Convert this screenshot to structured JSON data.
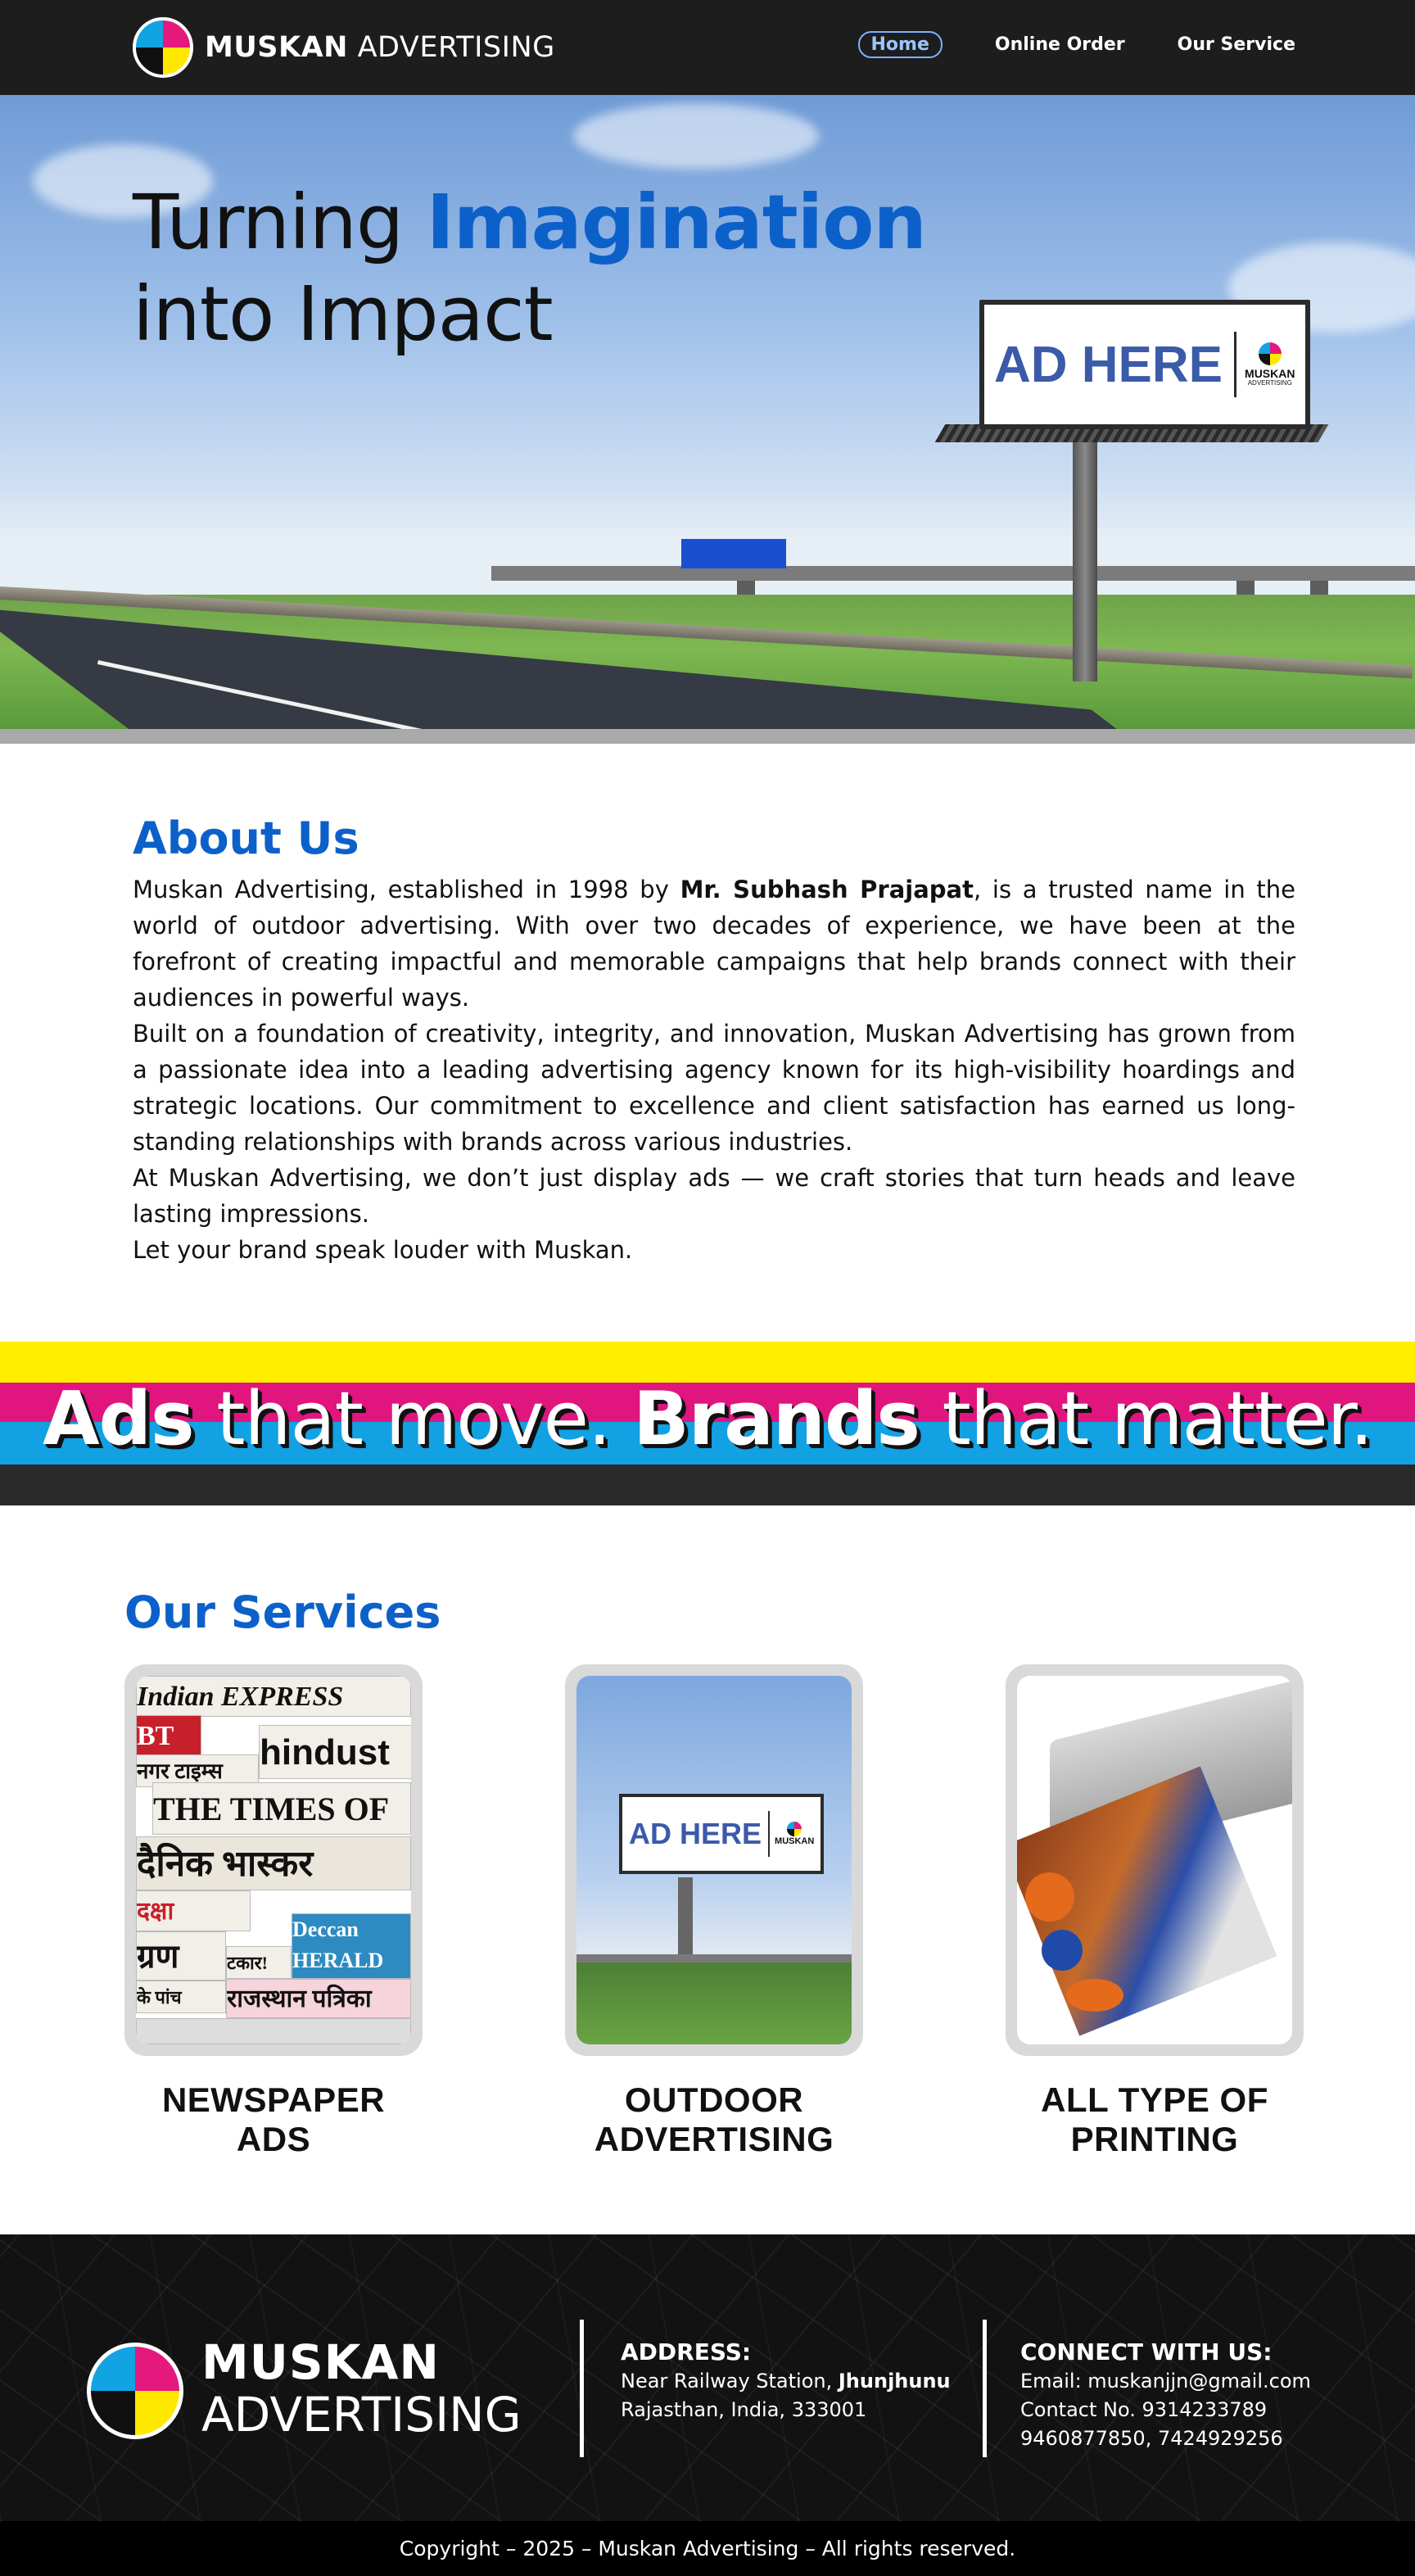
{
  "nav": {
    "brand_bold": "MUSKAN",
    "brand_light": "ADVERTISING",
    "links": [
      {
        "label": "Home",
        "active": true
      },
      {
        "label": "Online Order",
        "active": false
      },
      {
        "label": "Our Service",
        "active": false
      }
    ]
  },
  "hero": {
    "title_part1": "Turning ",
    "title_accent": "Imagination",
    "title_line2": "into Impact",
    "billboard_text": "AD HERE",
    "billboard_brand": "MUSKAN",
    "billboard_sub": "ADVERTISING"
  },
  "about": {
    "title": "About Us",
    "p1_pre": "Muskan Advertising, established in 1998 by ",
    "p1_bold": "Mr. Subhash Prajapat",
    "p1_post": ", is a trusted name in the world of outdoor advertising. With over two decades of experience, we have been at the forefront of creating impactful and memorable campaigns that help brands connect with their audiences in powerful ways.",
    "p2": "Built on a foundation of creativity, integrity, and innovation, Muskan Advertising has grown from a passionate idea into a leading advertising agency known for its high-visibility hoardings and strategic locations. Our commitment to excellence and client satisfaction has earned us long-standing relationships with brands across various industries.",
    "p3": "At Muskan Advertising, we don’t just display ads — we craft stories that turn heads and leave lasting impressions.",
    "p4": "Let your brand speak louder with Muskan."
  },
  "tagline": {
    "w1": "Ads",
    "w2": " that move. ",
    "w3": "Brands",
    "w4": " that matter."
  },
  "services": {
    "title": "Our Services",
    "items": [
      {
        "label_line1": "NEWSPAPER",
        "label_line2": "ADS"
      },
      {
        "label_line1": "OUTDOOR",
        "label_line2": "ADVERTISING"
      },
      {
        "label_line1": "ALL TYPE OF",
        "label_line2": "PRINTING"
      }
    ],
    "newspaper_headlines": [
      "Indian EXPRESS",
      "BT",
      "नगर टाइम्स",
      "hindust",
      "THE TIMES OF",
      "दैनिक भास्कर",
      "दक्षा",
      "Deccan HERALD",
      "राजस्थान पत्रिका",
      "ग्रण",
      "टकार!",
      "के पांच"
    ],
    "outdoor_billboard_text": "AD HERE",
    "outdoor_billboard_brand": "MUSKAN"
  },
  "footer": {
    "brand_line1": "MUSKAN",
    "brand_line2": "ADVERTISING",
    "address_heading": "ADDRESS:",
    "address_line1_pre": "Near Railway Station, ",
    "address_line1_bold": "Jhunjhunu",
    "address_line2": "Rajasthan, India, 333001",
    "connect_heading": "CONNECT WITH US:",
    "email": "Email: muskanjjn@gmail.com",
    "contact": "Contact No. 9314233789",
    "contact2": "9460877850, 7424929256"
  },
  "copyright": "Copyright – 2025 – Muskan Advertising – All rights reserved.",
  "colors": {
    "accent_blue": "#0c60c9",
    "cmyk_yellow": "#ffee00",
    "cmyk_magenta": "#e0157e",
    "cmyk_cyan": "#12a1e2",
    "nav_bg": "#1d1d1d"
  }
}
